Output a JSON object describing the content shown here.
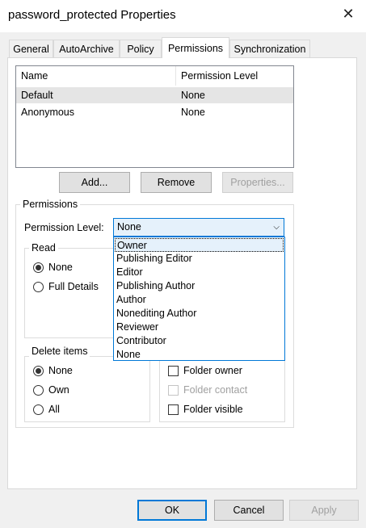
{
  "window": {
    "title": "password_protected Properties"
  },
  "tabs": [
    {
      "label": "General"
    },
    {
      "label": "AutoArchive"
    },
    {
      "label": "Policy"
    },
    {
      "label": "Permissions"
    },
    {
      "label": "Synchronization"
    }
  ],
  "user_list": {
    "headers": {
      "name": "Name",
      "level": "Permission Level"
    },
    "rows": [
      {
        "name": "Default",
        "level": "None"
      },
      {
        "name": "Anonymous",
        "level": "None"
      }
    ]
  },
  "list_buttons": {
    "add": "Add...",
    "remove": "Remove",
    "properties": "Properties..."
  },
  "permissions": {
    "group_label": "Permissions",
    "level_label": "Permission Level:",
    "level_value": "None",
    "level_options": [
      "Owner",
      "Publishing Editor",
      "Editor",
      "Publishing Author",
      "Author",
      "Nonediting Author",
      "Reviewer",
      "Contributor",
      "None"
    ],
    "highlighted_option": "Owner",
    "read": {
      "label": "Read",
      "options": [
        "None",
        "Full Details"
      ],
      "selected": "None"
    },
    "delete_items": {
      "label": "Delete items",
      "options": [
        "None",
        "Own",
        "All"
      ],
      "selected": "None"
    },
    "other": {
      "folder_owner": "Folder owner",
      "folder_contact": "Folder contact",
      "folder_visible": "Folder visible"
    }
  },
  "footer": {
    "ok": "OK",
    "cancel": "Cancel",
    "apply": "Apply"
  },
  "colors": {
    "accent": "#0078d7",
    "selection": "#e5f1fb",
    "window_bg": "#f0f0f0"
  }
}
